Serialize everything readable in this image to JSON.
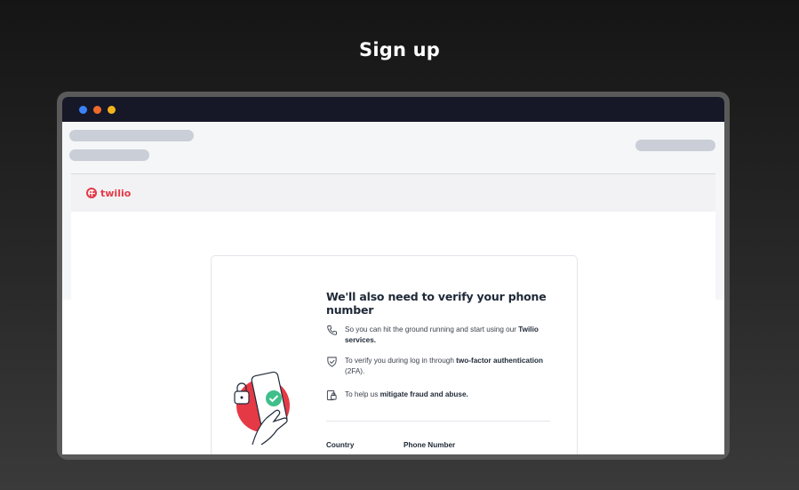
{
  "heading": "Sign up",
  "window": {
    "dots": [
      "#3b82f6",
      "#ef6a2a",
      "#f2b41c"
    ]
  },
  "brand": {
    "name": "twilio",
    "color": "#e63946"
  },
  "card": {
    "title": "We'll also need to verify your phone number",
    "bullets": [
      {
        "icon": "phone-icon",
        "text_pre": "So you can hit the ground running and start using our ",
        "text_bold": "Twilio services.",
        "text_post": ""
      },
      {
        "icon": "shield-check-icon",
        "text_pre": "To verify you during log in through ",
        "text_bold": "two-factor authentication",
        "text_post": " (2FA)."
      },
      {
        "icon": "lock-device-icon",
        "text_pre": "To help us ",
        "text_bold": "mitigate fraud and abuse.",
        "text_post": ""
      }
    ],
    "fields": {
      "country_label": "Country",
      "phone_label": "Phone Number"
    }
  }
}
